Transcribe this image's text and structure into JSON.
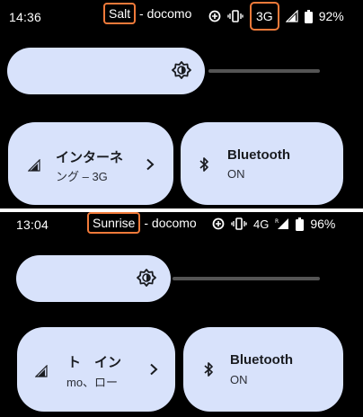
{
  "colors": {
    "background": "#000000",
    "tile": "#d8e2fb",
    "tile_text": "#1a1c21",
    "highlight": "#f07a3a",
    "track": "#545454"
  },
  "top": {
    "status": {
      "time": "14:36",
      "carrier_highlight": "Salt",
      "carrier_rest": " - docomo",
      "network": "3G",
      "battery": "92%",
      "icons": [
        "data-saver-icon",
        "vibrate-icon",
        "signal-icon",
        "battery-icon"
      ]
    },
    "tiles": {
      "internet": {
        "title": "インターネ",
        "subtitle": "ング – 3G",
        "icon": "signal-icon"
      },
      "bluetooth": {
        "title": "Bluetooth",
        "subtitle": "ON",
        "icon": "bluetooth-icon"
      }
    }
  },
  "bottom": {
    "status": {
      "time": "13:04",
      "carrier_highlight": "Sunrise",
      "carrier_rest": " - docomo",
      "network": "4G",
      "battery": "96%",
      "icons": [
        "data-saver-icon",
        "vibrate-icon",
        "roaming-signal-icon",
        "battery-icon"
      ]
    },
    "tiles": {
      "internet": {
        "title": "ト　イン",
        "subtitle": "mo、ロー",
        "icon": "signal-icon"
      },
      "bluetooth": {
        "title": "Bluetooth",
        "subtitle": "ON",
        "icon": "bluetooth-icon"
      }
    }
  }
}
